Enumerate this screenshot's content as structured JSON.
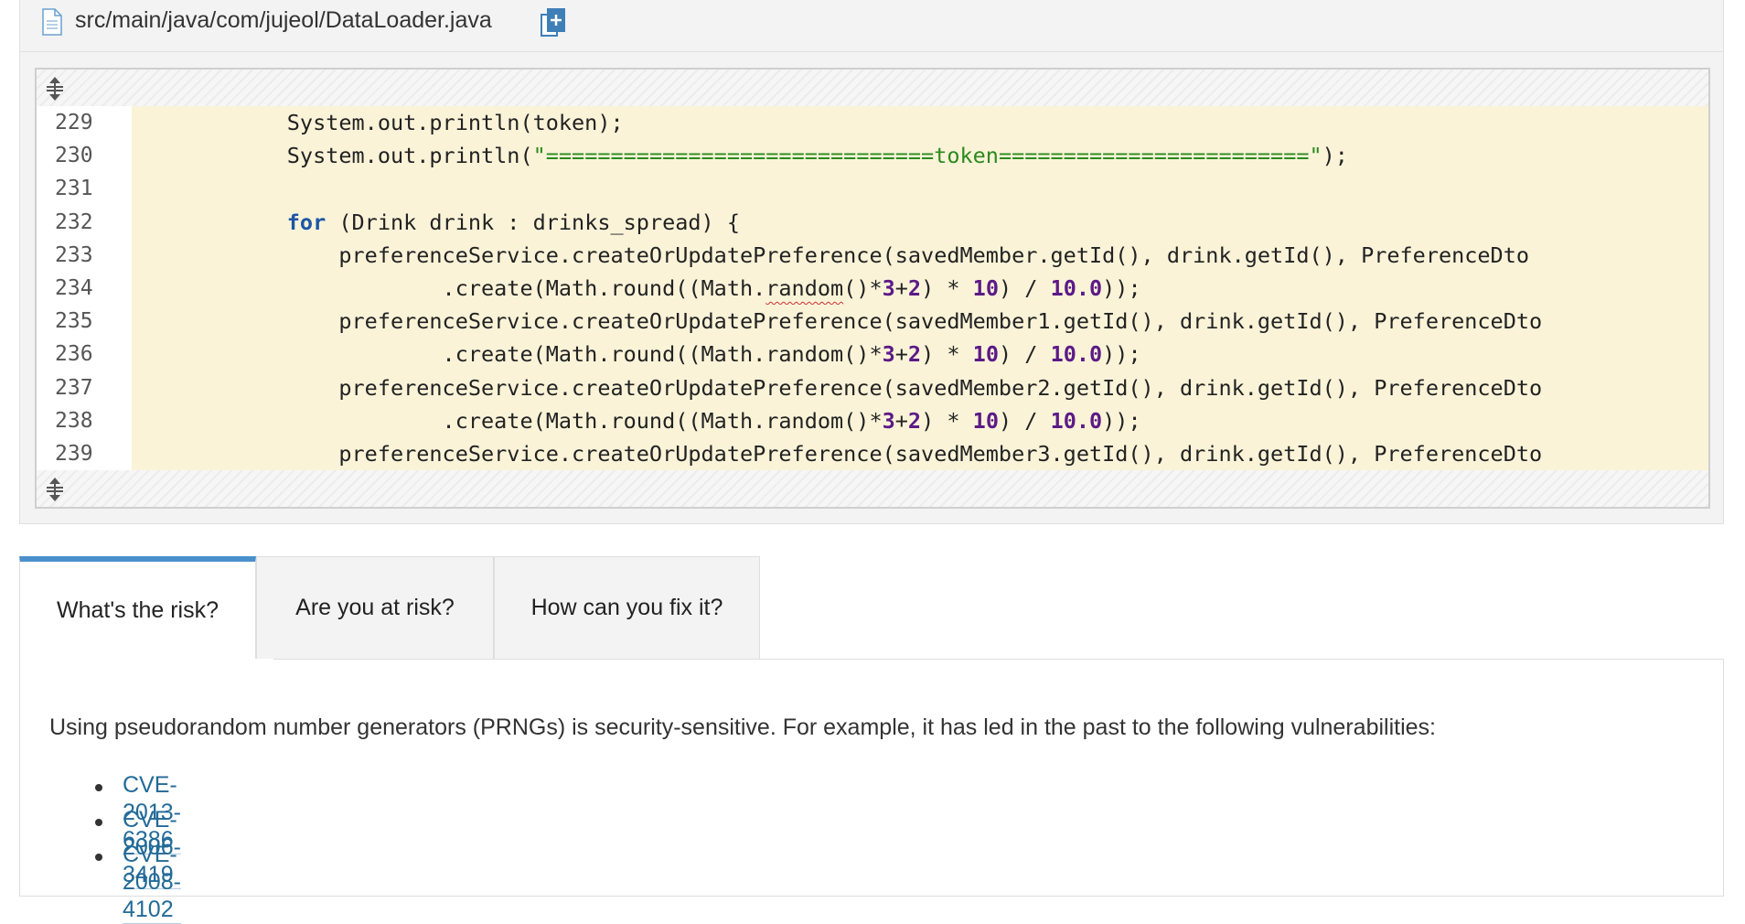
{
  "file": {
    "path": "src/main/java/com/jujeol/DataLoader.java",
    "file_icon": "document-icon",
    "copy_icon": "copy-path-icon"
  },
  "code": {
    "expand_icon": "expand-lines-icon",
    "lines": [
      {
        "number": "229",
        "html": "            System.out.println(token);"
      },
      {
        "number": "230",
        "html": "            System.out.println(<span class=\"str\">\"==============================token========================\"</span>);"
      },
      {
        "number": "231",
        "html": ""
      },
      {
        "number": "232",
        "html": "            <span class=\"kw\">for</span> (Drink drink : drinks_spread) {"
      },
      {
        "number": "233",
        "html": "                preferenceService.createOrUpdatePreference(savedMember.getId(), drink.getId(), PreferenceDto"
      },
      {
        "number": "234",
        "html": "                        .create(Math.round((Math.<span class=\"squiggle\">random</span>()*<span class=\"num\">3</span>+<span class=\"num\">2</span>) * <span class=\"num\">10</span>) / <span class=\"num\">10.0</span>));"
      },
      {
        "number": "235",
        "html": "                preferenceService.createOrUpdatePreference(savedMember1.getId(), drink.getId(), PreferenceDto"
      },
      {
        "number": "236",
        "html": "                        .create(Math.round((Math.random()*<span class=\"num\">3</span>+<span class=\"num\">2</span>) * <span class=\"num\">10</span>) / <span class=\"num\">10.0</span>));"
      },
      {
        "number": "237",
        "html": "                preferenceService.createOrUpdatePreference(savedMember2.getId(), drink.getId(), PreferenceDto"
      },
      {
        "number": "238",
        "html": "                        .create(Math.round((Math.random()*<span class=\"num\">3</span>+<span class=\"num\">2</span>) * <span class=\"num\">10</span>) / <span class=\"num\">10.0</span>));"
      },
      {
        "number": "239",
        "html": "                preferenceService.createOrUpdatePreference(savedMember3.getId(), drink.getId(), PreferenceDto"
      }
    ]
  },
  "tabs": [
    {
      "label": "What's the risk?",
      "active": true
    },
    {
      "label": "Are you at risk?",
      "active": false
    },
    {
      "label": "How can you fix it?",
      "active": false
    }
  ],
  "risk": {
    "description": "Using pseudorandom number generators (PRNGs) is security-sensitive. For example, it has led in the past to the following vulnerabilities:",
    "cves": [
      "CVE-2013-6386",
      "CVE-2006-3419",
      "CVE-2008-4102"
    ]
  },
  "colors": {
    "highlight": "#faf3d8",
    "tab_accent": "#4a90cc",
    "link": "#236a97"
  }
}
